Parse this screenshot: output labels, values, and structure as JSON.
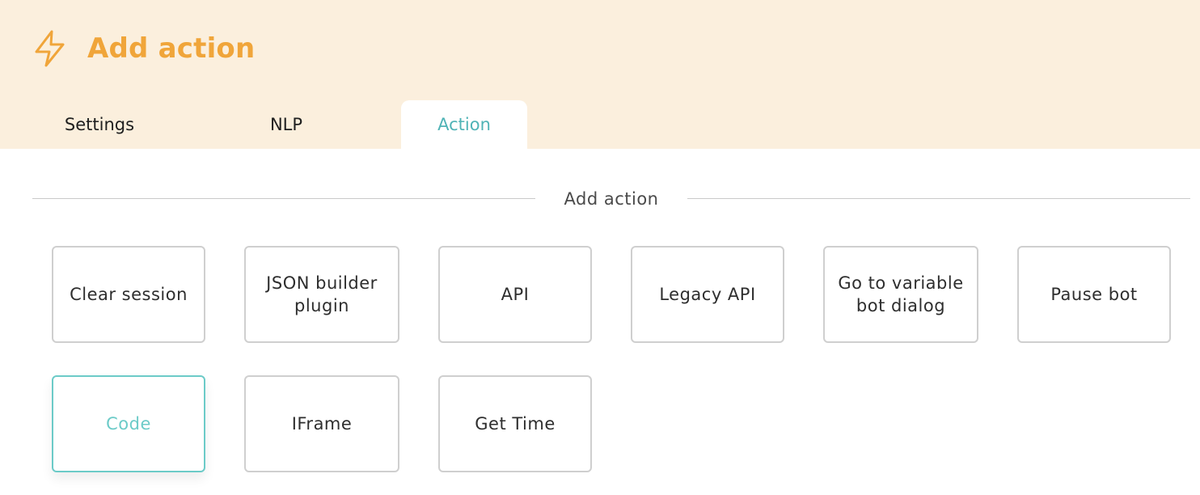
{
  "header": {
    "icon": "lightning-bolt-icon",
    "title": "Add action",
    "accent_color": "#f0a53a",
    "background_color": "#fbefdd"
  },
  "tabs": [
    {
      "label": "Settings",
      "active": false
    },
    {
      "label": "NLP",
      "active": false
    },
    {
      "label": "Action",
      "active": true
    }
  ],
  "section": {
    "label": "Add action"
  },
  "actions": [
    {
      "label": "Clear session",
      "selected": false
    },
    {
      "label": "JSON builder plugin",
      "selected": false
    },
    {
      "label": "API",
      "selected": false
    },
    {
      "label": "Legacy API",
      "selected": false
    },
    {
      "label": "Go to variable bot dialog",
      "selected": false
    },
    {
      "label": "Pause bot",
      "selected": false
    },
    {
      "label": "Code",
      "selected": true
    },
    {
      "label": "IFrame",
      "selected": false
    },
    {
      "label": "Get Time",
      "selected": false
    }
  ],
  "colors": {
    "active_tab_text": "#4fb3b6",
    "selected_card": "#6ccbc8",
    "card_border": "#cfcfcf"
  }
}
